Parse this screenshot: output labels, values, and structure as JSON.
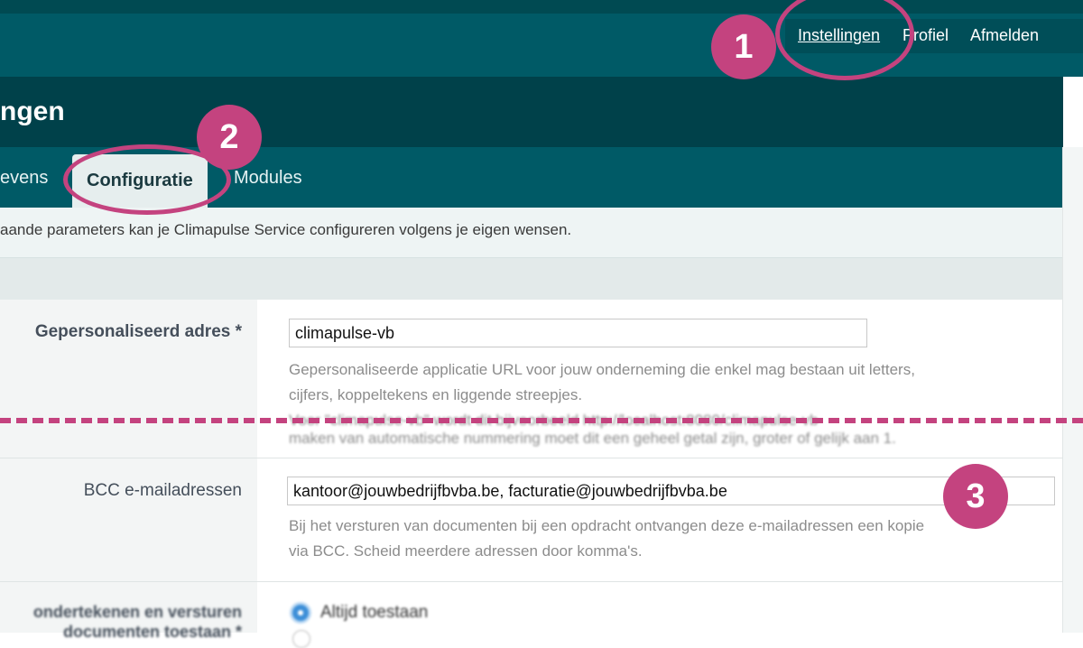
{
  "header": {
    "nav": {
      "settings": "Instellingen",
      "profile": "Profiel",
      "logout": "Afmelden"
    }
  },
  "page": {
    "title": "ngen"
  },
  "tabs": {
    "first": "evens",
    "active": "Configuratie",
    "third": "Modules"
  },
  "intro": "aande parameters kan je Climapulse Service configureren volgens je eigen wensen.",
  "fields": {
    "custom_address": {
      "label": "Gepersonaliseerd adres *",
      "value": "climapulse-vb",
      "help_1": "Gepersonaliseerde applicatie URL voor jouw onderneming die enkel mag bestaan uit letters,",
      "help_2": "cijfers, koppeltekens en liggende streepjes.",
      "help_3": "Voor \"climapulse-vb\" wordt dit bijvoorbeeld http://localhost:8080/climapulse-vb",
      "help_4": "maken van automatische nummering moet dit een geheel getal zijn, groter of gelijk aan 1."
    },
    "bcc": {
      "label": "BCC e-mailadressen",
      "value": "kantoor@jouwbedrijfbvba.be, facturatie@jouwbedrijfbvba.be",
      "help_1": "Bij het versturen van documenten bij een opdracht ontvangen deze e-mailadressen een kopie",
      "help_2": "via BCC. Scheid meerdere adressen door komma's."
    },
    "signing": {
      "label_1": "ondertekenen en versturen",
      "label_2": "documenten toestaan *",
      "option_1": "Altijd toestaan"
    }
  },
  "annotations": {
    "badge_1": "1",
    "badge_2": "2",
    "badge_3": "3",
    "color": "#c4437f"
  },
  "colors": {
    "header": "#005a66",
    "title_bar": "#00414a",
    "accent": "#c4437f"
  }
}
